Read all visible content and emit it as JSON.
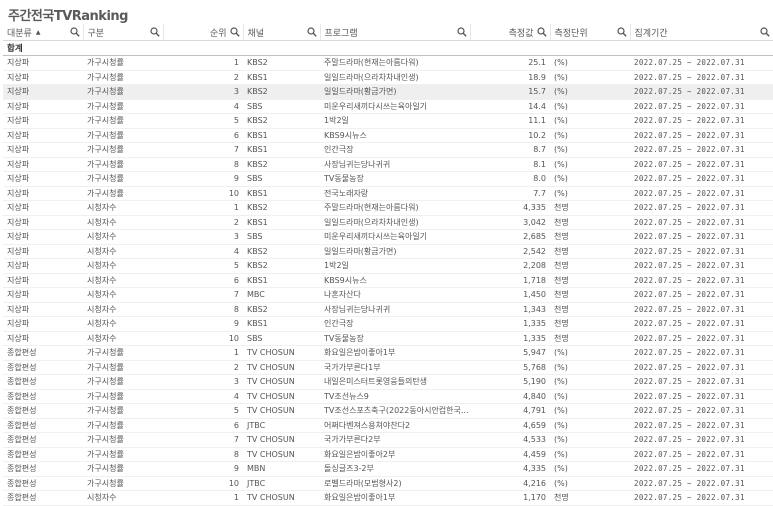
{
  "title": "주간전국TVRanking",
  "columns": [
    "대분류",
    "구분",
    "순위",
    "채널",
    "프로그램",
    "측정값",
    "측정단위",
    "집계기간"
  ],
  "total_label": "합계",
  "highlight_row": 2,
  "rows": [
    [
      "지상파",
      "가구시청률",
      "1",
      "KBS2",
      "주말드라마(현재는아름다워)",
      "25.1",
      "(%)",
      "2022.07.25 ~ 2022.07.31"
    ],
    [
      "지상파",
      "가구시청률",
      "2",
      "KBS1",
      "일일드라마(으라차차내인생)",
      "18.9",
      "(%)",
      "2022.07.25 ~ 2022.07.31"
    ],
    [
      "지상파",
      "가구시청률",
      "3",
      "KBS2",
      "일일드라마(황금가면)",
      "15.7",
      "(%)",
      "2022.07.25 ~ 2022.07.31"
    ],
    [
      "지상파",
      "가구시청률",
      "4",
      "SBS",
      "미운우리새끼다시쓰는육아일기",
      "14.4",
      "(%)",
      "2022.07.25 ~ 2022.07.31"
    ],
    [
      "지상파",
      "가구시청률",
      "5",
      "KBS2",
      "1박2일",
      "11.1",
      "(%)",
      "2022.07.25 ~ 2022.07.31"
    ],
    [
      "지상파",
      "가구시청률",
      "6",
      "KBS1",
      "KBS9시뉴스",
      "10.2",
      "(%)",
      "2022.07.25 ~ 2022.07.31"
    ],
    [
      "지상파",
      "가구시청률",
      "7",
      "KBS1",
      "인간극장",
      "8.7",
      "(%)",
      "2022.07.25 ~ 2022.07.31"
    ],
    [
      "지상파",
      "가구시청률",
      "8",
      "KBS2",
      "사장님귀는당나귀귀",
      "8.1",
      "(%)",
      "2022.07.25 ~ 2022.07.31"
    ],
    [
      "지상파",
      "가구시청률",
      "9",
      "SBS",
      "TV동물농장",
      "8.0",
      "(%)",
      "2022.07.25 ~ 2022.07.31"
    ],
    [
      "지상파",
      "가구시청률",
      "10",
      "KBS1",
      "전국노래자랑",
      "7.7",
      "(%)",
      "2022.07.25 ~ 2022.07.31"
    ],
    [
      "지상파",
      "시청자수",
      "1",
      "KBS2",
      "주말드라마(현재는아름다워)",
      "4,335",
      "천명",
      "2022.07.25 ~ 2022.07.31"
    ],
    [
      "지상파",
      "시청자수",
      "2",
      "KBS1",
      "일일드라마(으라차차내인생)",
      "3,042",
      "천명",
      "2022.07.25 ~ 2022.07.31"
    ],
    [
      "지상파",
      "시청자수",
      "3",
      "SBS",
      "미운우리새끼다시쓰는육아일기",
      "2,685",
      "천명",
      "2022.07.25 ~ 2022.07.31"
    ],
    [
      "지상파",
      "시청자수",
      "4",
      "KBS2",
      "일일드라마(황금가면)",
      "2,542",
      "천명",
      "2022.07.25 ~ 2022.07.31"
    ],
    [
      "지상파",
      "시청자수",
      "5",
      "KBS2",
      "1박2일",
      "2,208",
      "천명",
      "2022.07.25 ~ 2022.07.31"
    ],
    [
      "지상파",
      "시청자수",
      "6",
      "KBS1",
      "KBS9시뉴스",
      "1,718",
      "천명",
      "2022.07.25 ~ 2022.07.31"
    ],
    [
      "지상파",
      "시청자수",
      "7",
      "MBC",
      "나혼자산다",
      "1,450",
      "천명",
      "2022.07.25 ~ 2022.07.31"
    ],
    [
      "지상파",
      "시청자수",
      "8",
      "KBS2",
      "사장님귀는당나귀귀",
      "1,343",
      "천명",
      "2022.07.25 ~ 2022.07.31"
    ],
    [
      "지상파",
      "시청자수",
      "9",
      "KBS1",
      "인간극장",
      "1,335",
      "천명",
      "2022.07.25 ~ 2022.07.31"
    ],
    [
      "지상파",
      "시청자수",
      "10",
      "SBS",
      "TV동물농장",
      "1,335",
      "천명",
      "2022.07.25 ~ 2022.07.31"
    ],
    [
      "종합편성",
      "가구시청률",
      "1",
      "TV CHOSUN",
      "화요일은밤이좋아1부",
      "5,947",
      "(%)",
      "2022.07.25 ~ 2022.07.31"
    ],
    [
      "종합편성",
      "가구시청률",
      "2",
      "TV CHOSUN",
      "국가가부른다1부",
      "5,768",
      "(%)",
      "2022.07.25 ~ 2022.07.31"
    ],
    [
      "종합편성",
      "가구시청률",
      "3",
      "TV CHOSUN",
      "내일은미스터트롯영웅들의탄생",
      "5,190",
      "(%)",
      "2022.07.25 ~ 2022.07.31"
    ],
    [
      "종합편성",
      "가구시청률",
      "4",
      "TV CHOSUN",
      "TV조선뉴스9",
      "4,840",
      "(%)",
      "2022.07.25 ~ 2022.07.31"
    ],
    [
      "종합편성",
      "가구시청률",
      "5",
      "TV CHOSUN",
      "TV조선스포츠축구(2022동아시안컵한국...",
      "4,791",
      "(%)",
      "2022.07.25 ~ 2022.07.31"
    ],
    [
      "종합편성",
      "가구시청률",
      "6",
      "JTBC",
      "어쩌다벤져스용쳐야찬다2",
      "4,659",
      "(%)",
      "2022.07.25 ~ 2022.07.31"
    ],
    [
      "종합편성",
      "가구시청률",
      "7",
      "TV CHOSUN",
      "국가가부른다2부",
      "4,533",
      "(%)",
      "2022.07.25 ~ 2022.07.31"
    ],
    [
      "종합편성",
      "가구시청률",
      "8",
      "TV CHOSUN",
      "화요일은밤이좋아2부",
      "4,459",
      "(%)",
      "2022.07.25 ~ 2022.07.31"
    ],
    [
      "종합편성",
      "가구시청률",
      "9",
      "MBN",
      "돌싱글즈3-2부",
      "4,335",
      "(%)",
      "2022.07.25 ~ 2022.07.31"
    ],
    [
      "종합편성",
      "가구시청률",
      "10",
      "JTBC",
      "로벨드라마(모범형사2)",
      "4,216",
      "(%)",
      "2022.07.25 ~ 2022.07.31"
    ],
    [
      "종합편성",
      "시청자수",
      "1",
      "TV CHOSUN",
      "화요일은밤이좋아1부",
      "1,170",
      "천명",
      "2022.07.25 ~ 2022.07.31"
    ]
  ]
}
